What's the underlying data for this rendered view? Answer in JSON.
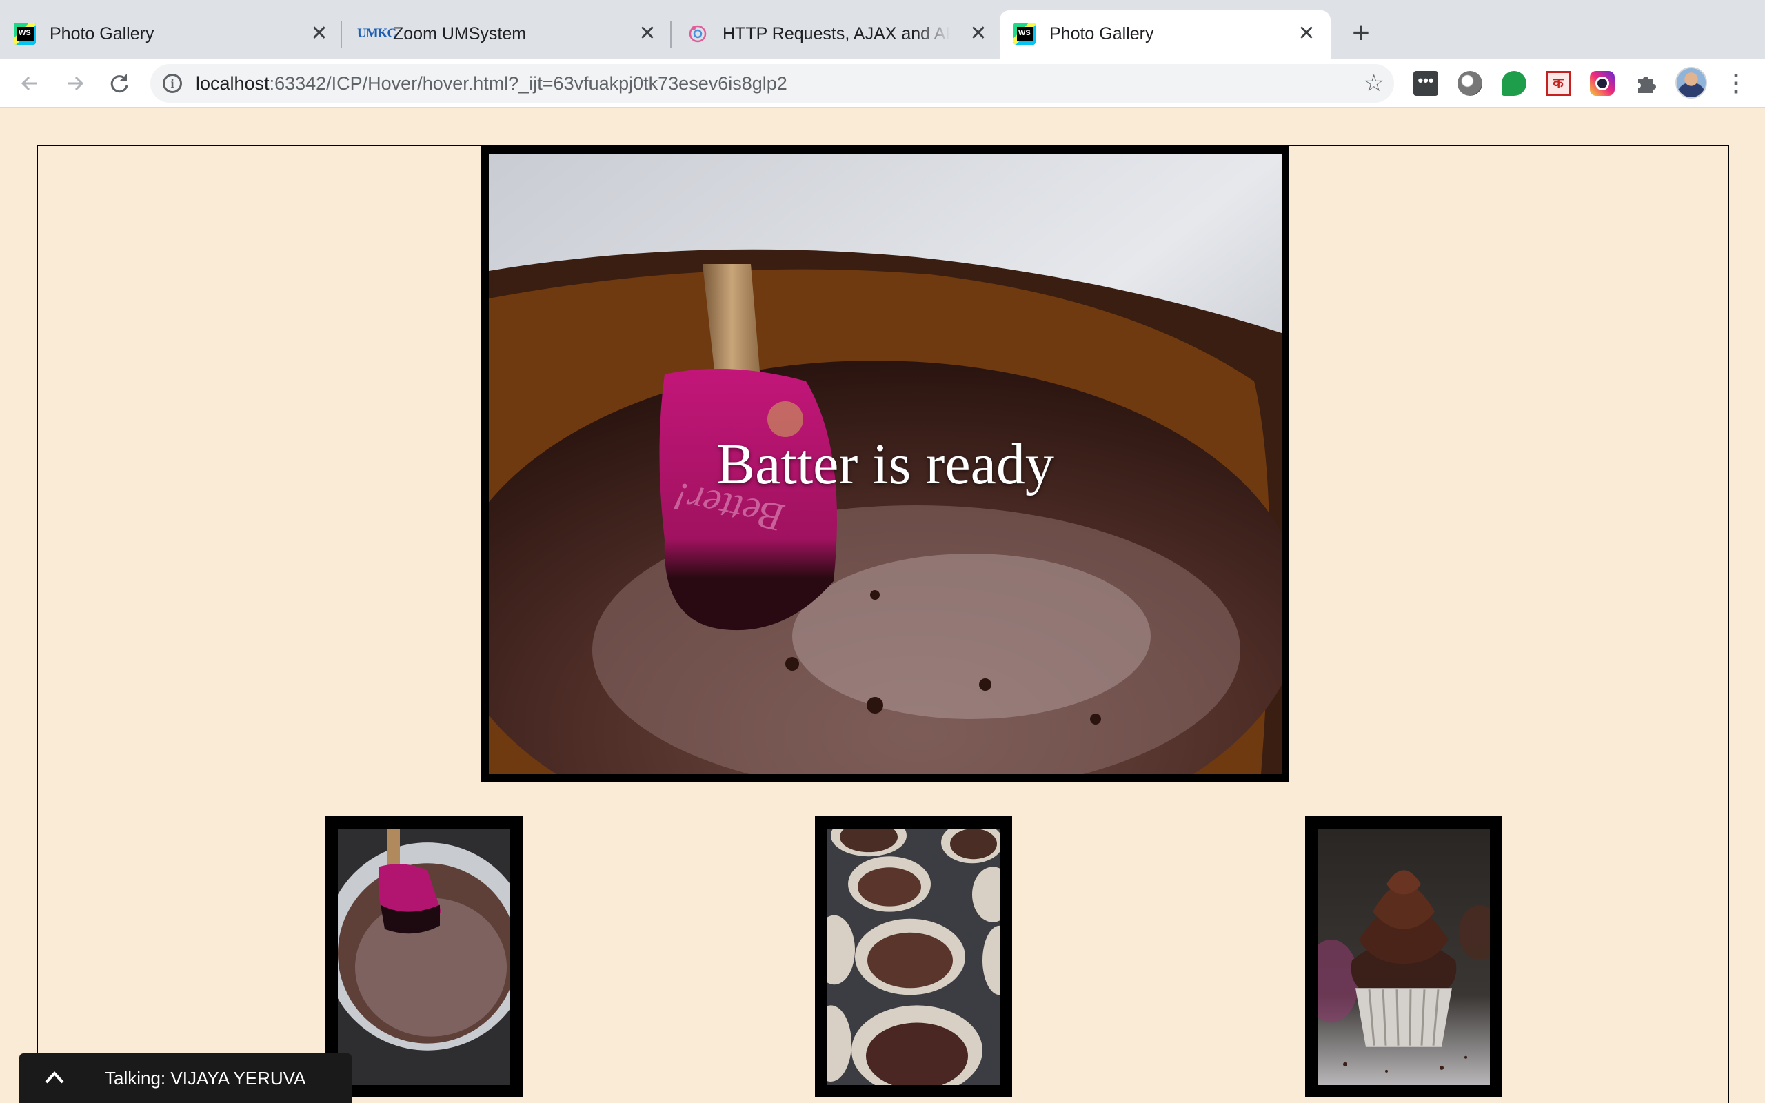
{
  "browser": {
    "tabs": [
      {
        "title": "Photo Gallery",
        "icon": "webstorm-icon",
        "active": false
      },
      {
        "title": "Zoom UMSystem",
        "icon": "umkc-icon",
        "active": false
      },
      {
        "title": "HTTP Requests, AJAX and API",
        "icon": "ajax-icon",
        "active": false
      },
      {
        "title": "Photo Gallery",
        "icon": "webstorm-icon",
        "active": true
      }
    ],
    "new_tab_symbol": "+",
    "close_symbol": "✕",
    "url_host": "localhost",
    "url_rest": ":63342/ICP/Hover/hover.html?_ijt=63vfuakpj0tk73esev6is8glp2",
    "umkc_label": "UMKC",
    "extension_ka_label": "क",
    "extensions": [
      "more-dots-extension",
      "grey-circle-extension",
      "green-chat-extension",
      "hindi-ka-extension",
      "instagram-extension",
      "puzzle-extensions-icon"
    ]
  },
  "gallery": {
    "main_caption": "Batter is ready",
    "thumbnails": [
      {
        "subject": "batter-bowl-with-spatula"
      },
      {
        "subject": "muffin-tin-with-batter"
      },
      {
        "subject": "frosted-chocolate-cupcake"
      }
    ]
  },
  "zoom": {
    "talking_label": "Talking: VIJAYA YERUVA"
  },
  "colors": {
    "page_background": "#faebd7",
    "frame": "#000000",
    "spatula": "#b0146f"
  }
}
